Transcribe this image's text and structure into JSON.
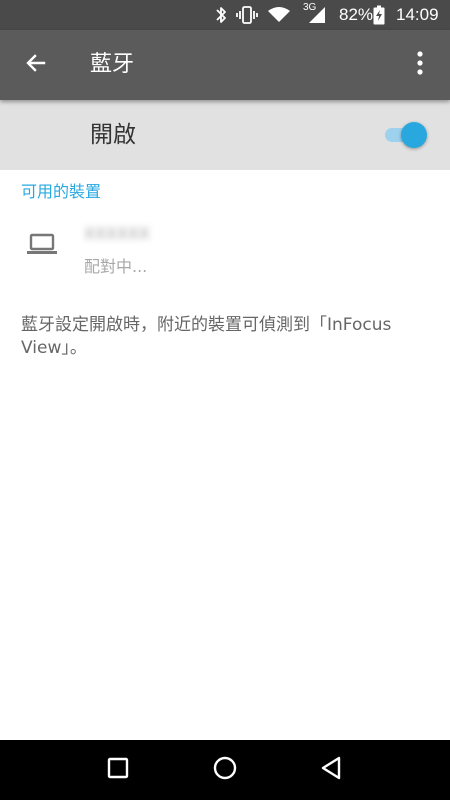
{
  "status_bar": {
    "network_label": "3G",
    "battery": "82%",
    "time": "14:09",
    "icons": [
      "bluetooth-icon",
      "vibrate-icon",
      "wifi-icon",
      "cell-signal-icon",
      "battery-charging-icon"
    ]
  },
  "app_bar": {
    "title": "藍牙",
    "back_icon": "arrow-back-icon",
    "menu_icon": "more-vertical-icon"
  },
  "master_switch": {
    "label": "開啟",
    "on": true,
    "accent_color": "#29a8e0"
  },
  "available_devices": {
    "header": "可用的裝置",
    "items": [
      {
        "icon": "laptop-icon",
        "name": "XXXXXX",
        "status": "配對中..."
      }
    ]
  },
  "info": {
    "text": "藍牙設定開啟時，附近的裝置可偵測到「InFocus View」。"
  },
  "nav_bar": {
    "icons": [
      "recent-apps-icon",
      "home-icon",
      "back-icon"
    ]
  }
}
